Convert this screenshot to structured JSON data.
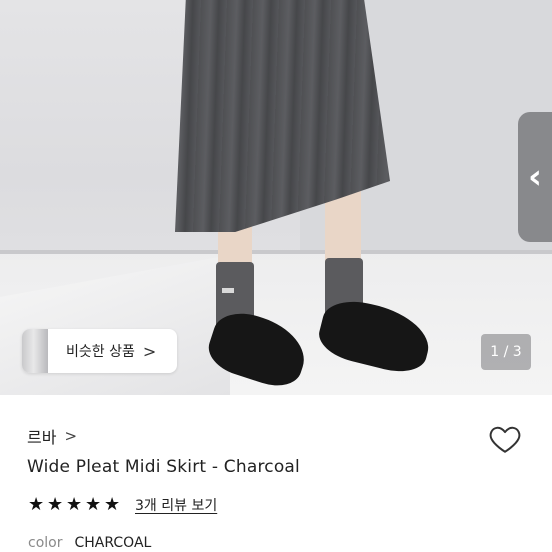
{
  "gallery": {
    "similar_button_label": "비슷한 상품",
    "similar_button_chevron": ">",
    "counter": "1 / 3",
    "next_arrow": "‹"
  },
  "product": {
    "store_name": "르바",
    "store_chevron": ">",
    "title": "Wide Pleat Midi Skirt - Charcoal",
    "rating": 5,
    "stars": [
      "★",
      "★",
      "★",
      "★",
      "★"
    ],
    "reviews_link": "3개 리뷰 보기",
    "color_label": "color",
    "color_value": "CHARCOAL"
  },
  "icons": {
    "wishlist": "heart-outline-icon",
    "star": "star-filled-icon"
  }
}
